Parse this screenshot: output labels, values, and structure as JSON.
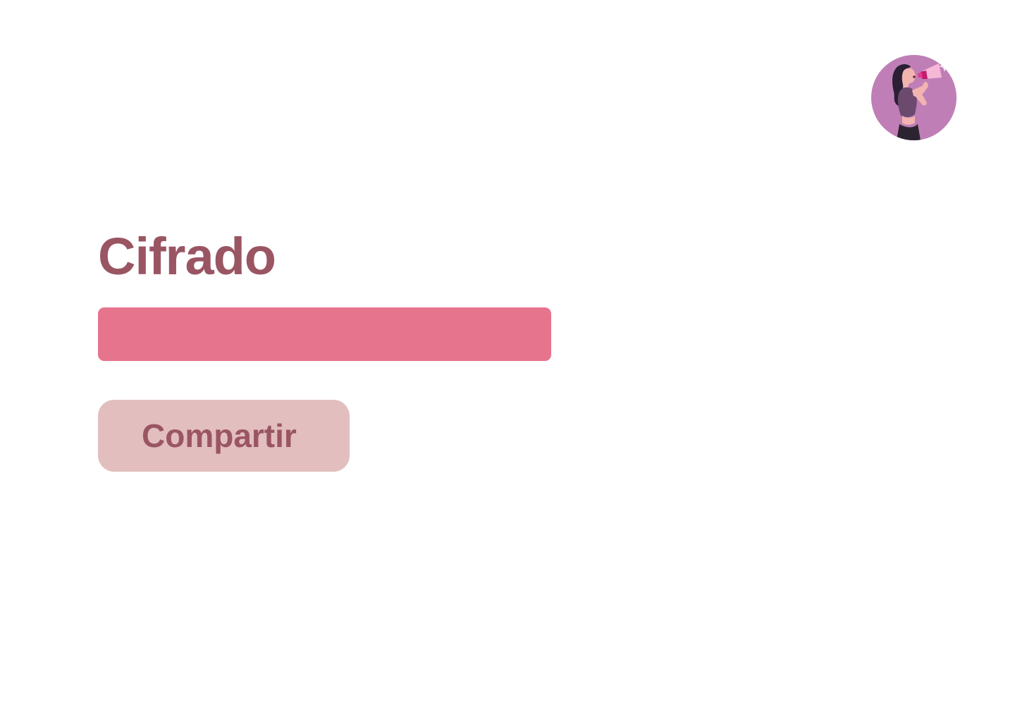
{
  "app": {
    "avatar_icon": "woman-with-megaphone-avatar-icon"
  },
  "main": {
    "title": "Cifrado",
    "cipher_input": {
      "value": "",
      "placeholder": ""
    },
    "share_button_label": "Compartir"
  },
  "colors": {
    "title": "#9a5563",
    "input_background": "#e7748d",
    "button_background": "#e2bebf",
    "avatar_background": "#bf7fb6"
  }
}
